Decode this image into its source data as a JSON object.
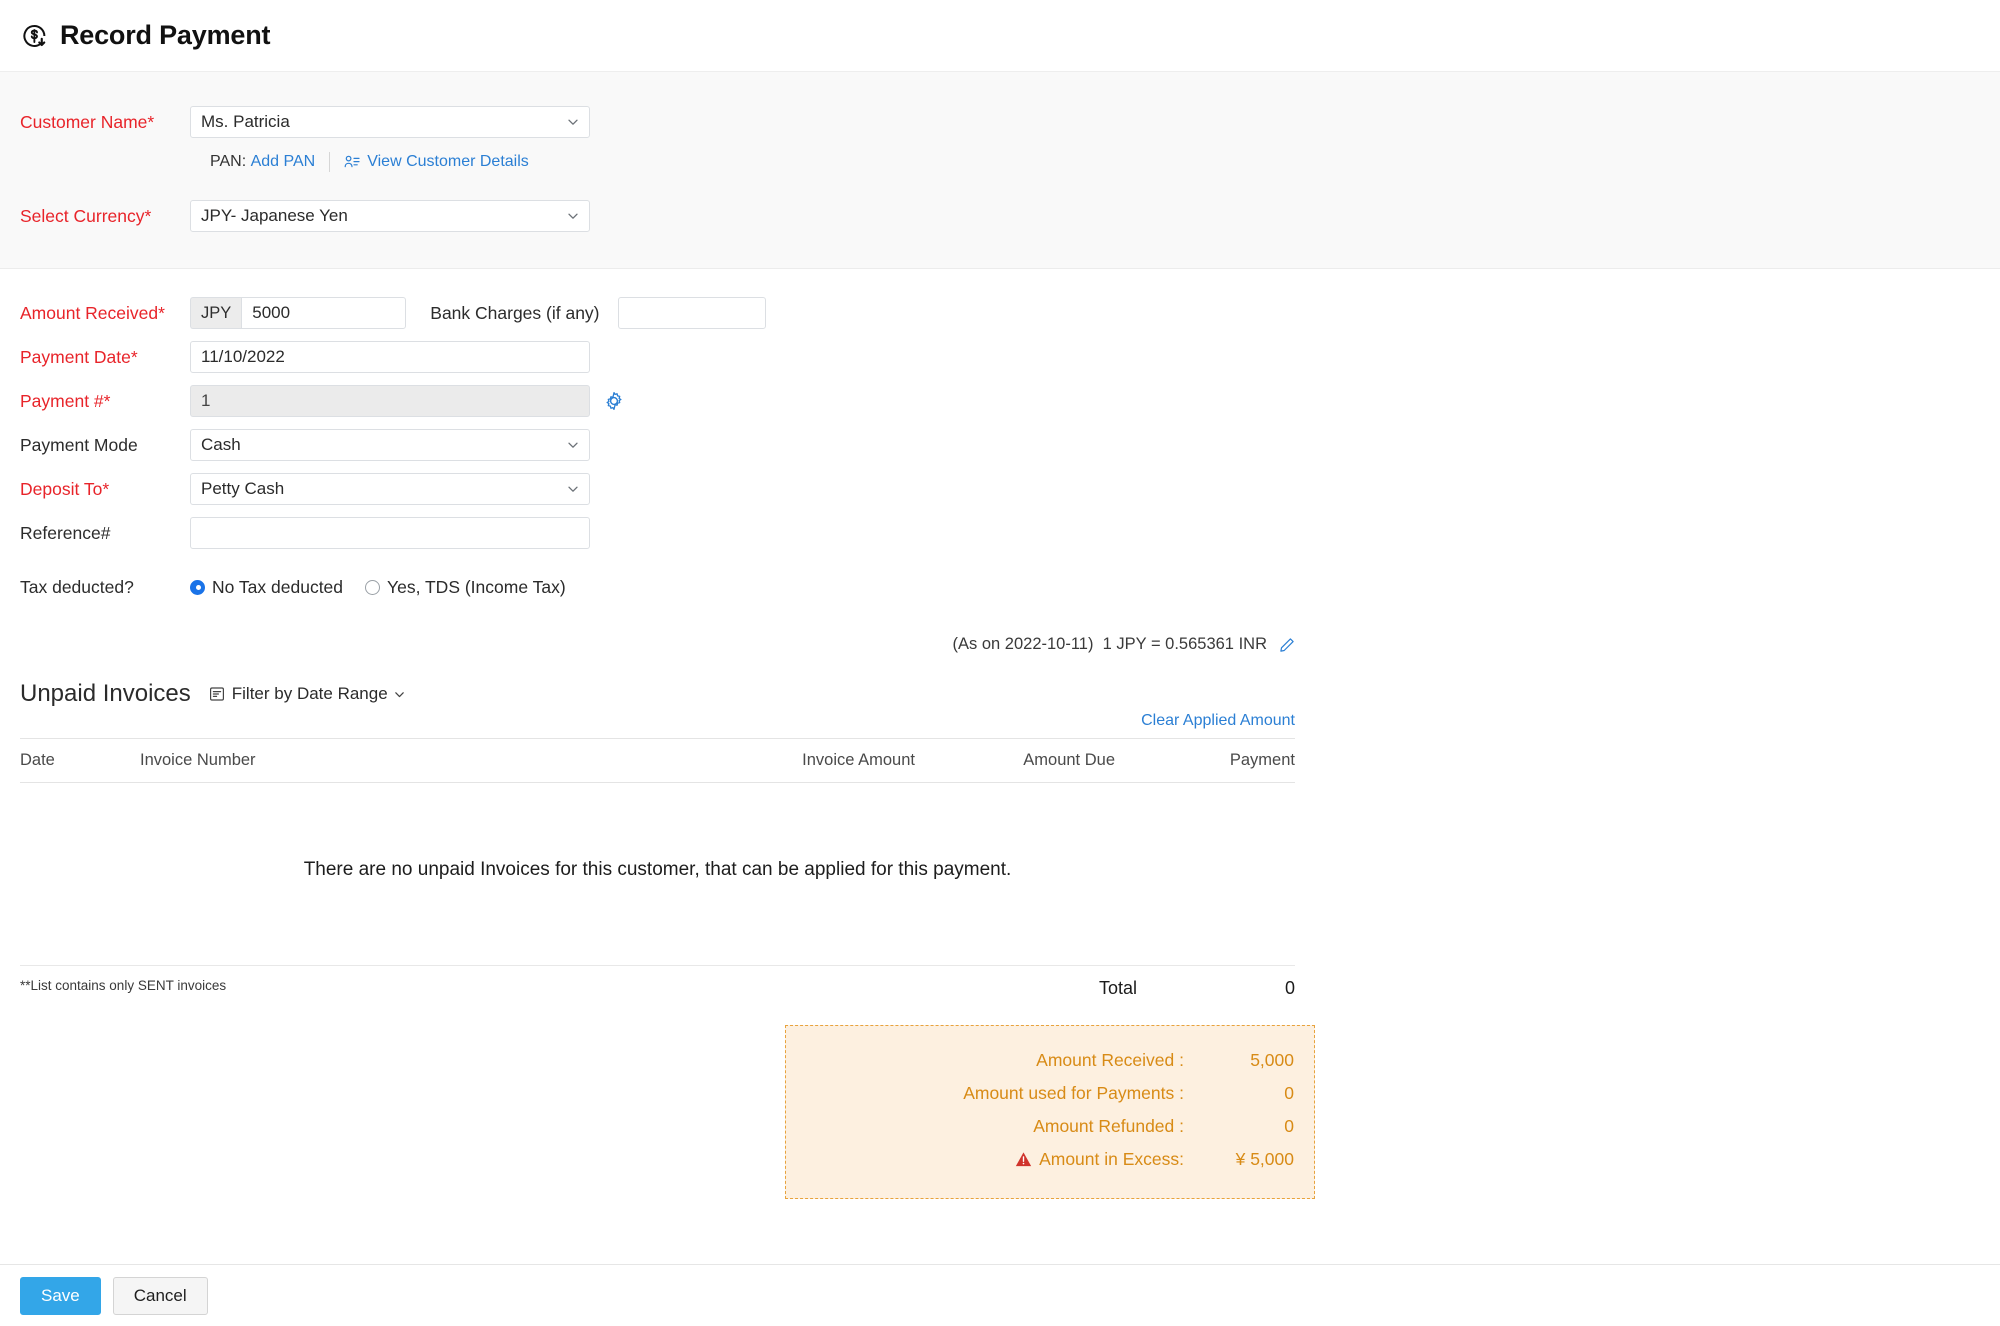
{
  "header": {
    "title": "Record Payment",
    "icon": "payment-received-icon"
  },
  "form": {
    "customer_name": {
      "label": "Customer Name*",
      "value": "Ms. Patricia",
      "pan_prefix": "PAN:",
      "add_pan_label": "Add PAN",
      "view_customer_label": "View Customer Details"
    },
    "currency": {
      "label": "Select Currency*",
      "value": "JPY- Japanese Yen"
    },
    "amount_received": {
      "label": "Amount Received*",
      "currency_code": "JPY",
      "value": "5000"
    },
    "bank_charges": {
      "label": "Bank Charges (if any)",
      "value": "",
      "placeholder": ""
    },
    "payment_date": {
      "label": "Payment Date*",
      "value": "11/10/2022"
    },
    "payment_number": {
      "label": "Payment #*",
      "value": "1"
    },
    "payment_mode": {
      "label": "Payment Mode",
      "value": "Cash"
    },
    "deposit_to": {
      "label": "Deposit To*",
      "value": "Petty Cash"
    },
    "reference": {
      "label": "Reference#",
      "value": "",
      "placeholder": ""
    },
    "tax_deducted": {
      "label": "Tax deducted?",
      "options": [
        {
          "label": "No Tax deducted",
          "selected": true
        },
        {
          "label": "Yes, TDS (Income Tax)",
          "selected": false
        }
      ]
    }
  },
  "exchange_rate": {
    "as_on": "(As on 2022-10-11)",
    "rate": "1 JPY = 0.565361 INR"
  },
  "unpaid_invoices": {
    "title": "Unpaid Invoices",
    "filter_label": "Filter by Date Range",
    "clear_applied_label": "Clear Applied Amount",
    "columns": [
      "Date",
      "Invoice Number",
      "Invoice Amount",
      "Amount Due",
      "Payment"
    ],
    "rows": [],
    "empty_message": "There are no unpaid Invoices for this customer, that can be applied for this payment.",
    "footnote": "**List contains only SENT invoices",
    "total_label": "Total",
    "total_value": "0"
  },
  "summary": {
    "rows": [
      {
        "label": "Amount Received :",
        "value": "5,000",
        "warning": false
      },
      {
        "label": "Amount used for Payments :",
        "value": "0",
        "warning": false
      },
      {
        "label": "Amount Refunded :",
        "value": "0",
        "warning": false
      },
      {
        "label": "Amount in Excess:",
        "value": "¥ 5,000",
        "warning": true
      }
    ]
  },
  "footer": {
    "save_label": "Save",
    "cancel_label": "Cancel"
  },
  "colors": {
    "required": "#e8242a",
    "link": "#2b7fd4",
    "primary_button": "#33a6e8",
    "summary_text": "#d88b16",
    "summary_bg": "#fdf0e0",
    "warning": "#d0342c"
  }
}
